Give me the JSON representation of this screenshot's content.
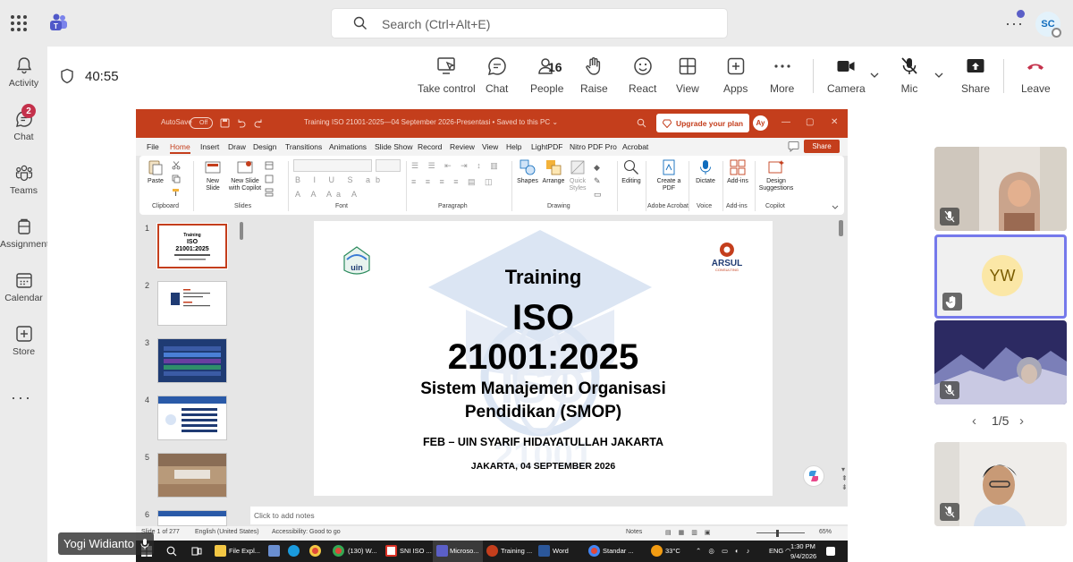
{
  "teams": {
    "search_placeholder": "Search (Ctrl+Alt+E)",
    "user_initials": "SC",
    "rail": [
      {
        "label": "Activity",
        "icon": "bell-icon"
      },
      {
        "label": "Chat",
        "icon": "chat-icon",
        "badge": "2"
      },
      {
        "label": "Teams",
        "icon": "teams-icon"
      },
      {
        "label": "Assignments",
        "icon": "assignments-icon"
      },
      {
        "label": "Calendar",
        "icon": "calendar-icon"
      },
      {
        "label": "Store",
        "icon": "store-icon"
      }
    ]
  },
  "meeting": {
    "timer": "40:55",
    "people_count": "16",
    "toolbar": {
      "take_control": "Take control",
      "chat": "Chat",
      "people": "People",
      "raise": "Raise",
      "react": "React",
      "view": "View",
      "apps": "Apps",
      "more": "More",
      "camera": "Camera",
      "mic": "Mic",
      "share": "Share",
      "leave": "Leave"
    },
    "presenter_name": "Yogi Widianto",
    "gallery": {
      "avatar_initials": "YW",
      "page": "1/5"
    }
  },
  "ppt": {
    "autosave_label": "AutoSave",
    "autosave_state": "Off",
    "doc_title": "Training ISO 21001-2025—04 September 2026-Presentasi • Saved to this PC ⌄",
    "upgrade": "Upgrade your plan",
    "user_initials": "Ay",
    "menu": [
      "File",
      "Home",
      "Insert",
      "Draw",
      "Design",
      "Transitions",
      "Animations",
      "Slide Show",
      "Record",
      "Review",
      "View",
      "Help",
      "LightPDF",
      "Nitro PDF Pro",
      "Acrobat"
    ],
    "share": "Share",
    "ribbon": {
      "paste": "Paste",
      "new_slide": "New Slide",
      "new_slide_copilot": "New Slide with Copilot",
      "shapes": "Shapes",
      "arrange": "Arrange",
      "quick_styles": "Quick Styles",
      "editing": "Editing",
      "create_pdf": "Create a PDF",
      "dictate": "Dictate",
      "addins": "Add-ins",
      "design_suggestions": "Design Suggestions",
      "groups": [
        "Clipboard",
        "Slides",
        "Font",
        "Paragraph",
        "Drawing",
        "Adobe Acrobat",
        "Voice",
        "Add-ins",
        "Copilot"
      ]
    },
    "thumb_numbers": [
      "1",
      "2",
      "3",
      "4",
      "5",
      "6"
    ],
    "slide": {
      "logo_left": "uin",
      "logo_right_name": "ARSUL",
      "logo_right_sub": "CONSULTING",
      "line1": "Training",
      "line2": "ISO",
      "line3": "21001:2025",
      "line4": "Sistem Manajemen Organisasi",
      "line5": "Pendidikan (SMOP)",
      "line6": "FEB – UIN SYARIF HIDAYATULLAH JAKARTA",
      "line7": "JAKARTA, 04 SEPTEMBER 2026",
      "watermark_top": "ISO",
      "watermark_bottom": "21001"
    },
    "notes_placeholder": "Click to add notes",
    "status": {
      "slide_of": "Slide 1 of 277",
      "language": "English (United States)",
      "accessibility": "Accessibility: Good to go",
      "notes": "Notes",
      "zoom": "65%"
    }
  },
  "taskbar": {
    "apps": [
      "File Expl...",
      "(130) W...",
      "SNI ISO ...",
      "Microso...",
      "Training ...",
      "Word",
      "Standar ..."
    ],
    "weather": "33°C",
    "lang": "ENG",
    "time": "1:30 PM",
    "date": "9/4/2026"
  }
}
